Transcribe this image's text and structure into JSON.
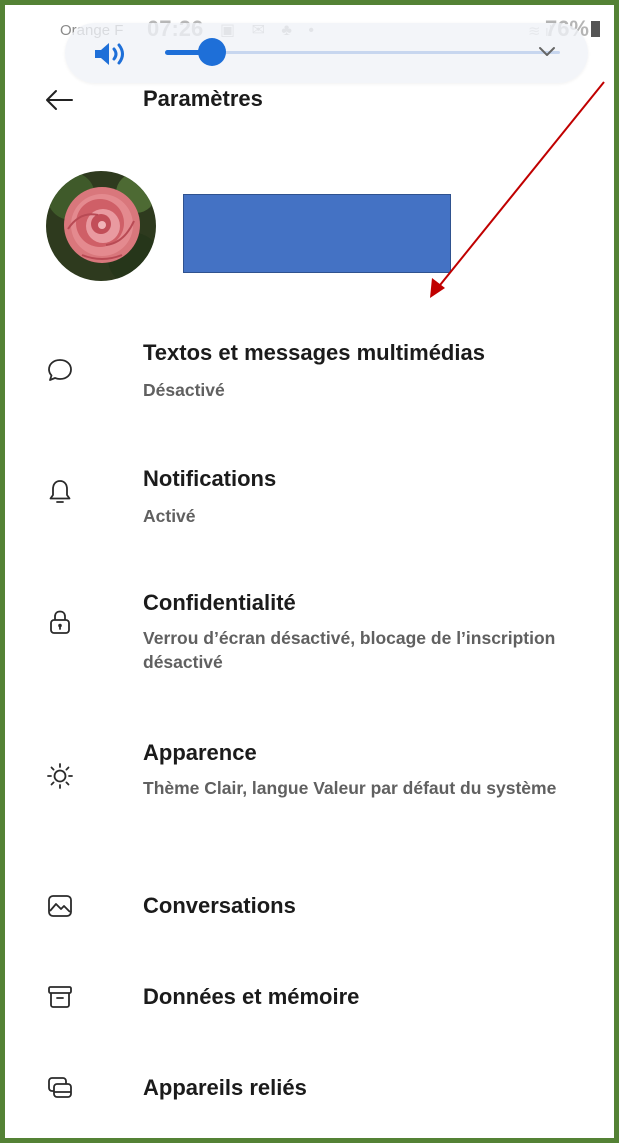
{
  "status_bar": {
    "carrier": "Orange F",
    "time": "07:26",
    "battery": "76%"
  },
  "volume_panel": {
    "level": 0.12
  },
  "header": {
    "title": "Paramètres"
  },
  "settings": [
    {
      "key": "sms",
      "icon": "chat-bubble-icon",
      "label": "Textos et messages multimédias",
      "subtitle": "Désactivé"
    },
    {
      "key": "notifications",
      "icon": "bell-icon",
      "label": "Notifications",
      "subtitle": "Activé"
    },
    {
      "key": "privacy",
      "icon": "lock-icon",
      "label": "Confidentialité",
      "subtitle": "Verrou d’écran désactivé, blocage de l’inscription désactivé"
    },
    {
      "key": "appearance",
      "icon": "sun-icon",
      "label": "Apparence",
      "subtitle": "Thème Clair, langue Valeur par défaut du système"
    },
    {
      "key": "conversations",
      "icon": "image-icon",
      "label": "Conversations",
      "subtitle": ""
    },
    {
      "key": "data",
      "icon": "archive-icon",
      "label": "Données et mémoire",
      "subtitle": ""
    },
    {
      "key": "devices",
      "icon": "linked-devices-icon",
      "label": "Appareils reliés",
      "subtitle": ""
    }
  ],
  "colors": {
    "frame_border": "#548235",
    "accent": "#1e6fd8",
    "redaction_box": "#4472c4",
    "annotation_arrow": "#c00000"
  }
}
